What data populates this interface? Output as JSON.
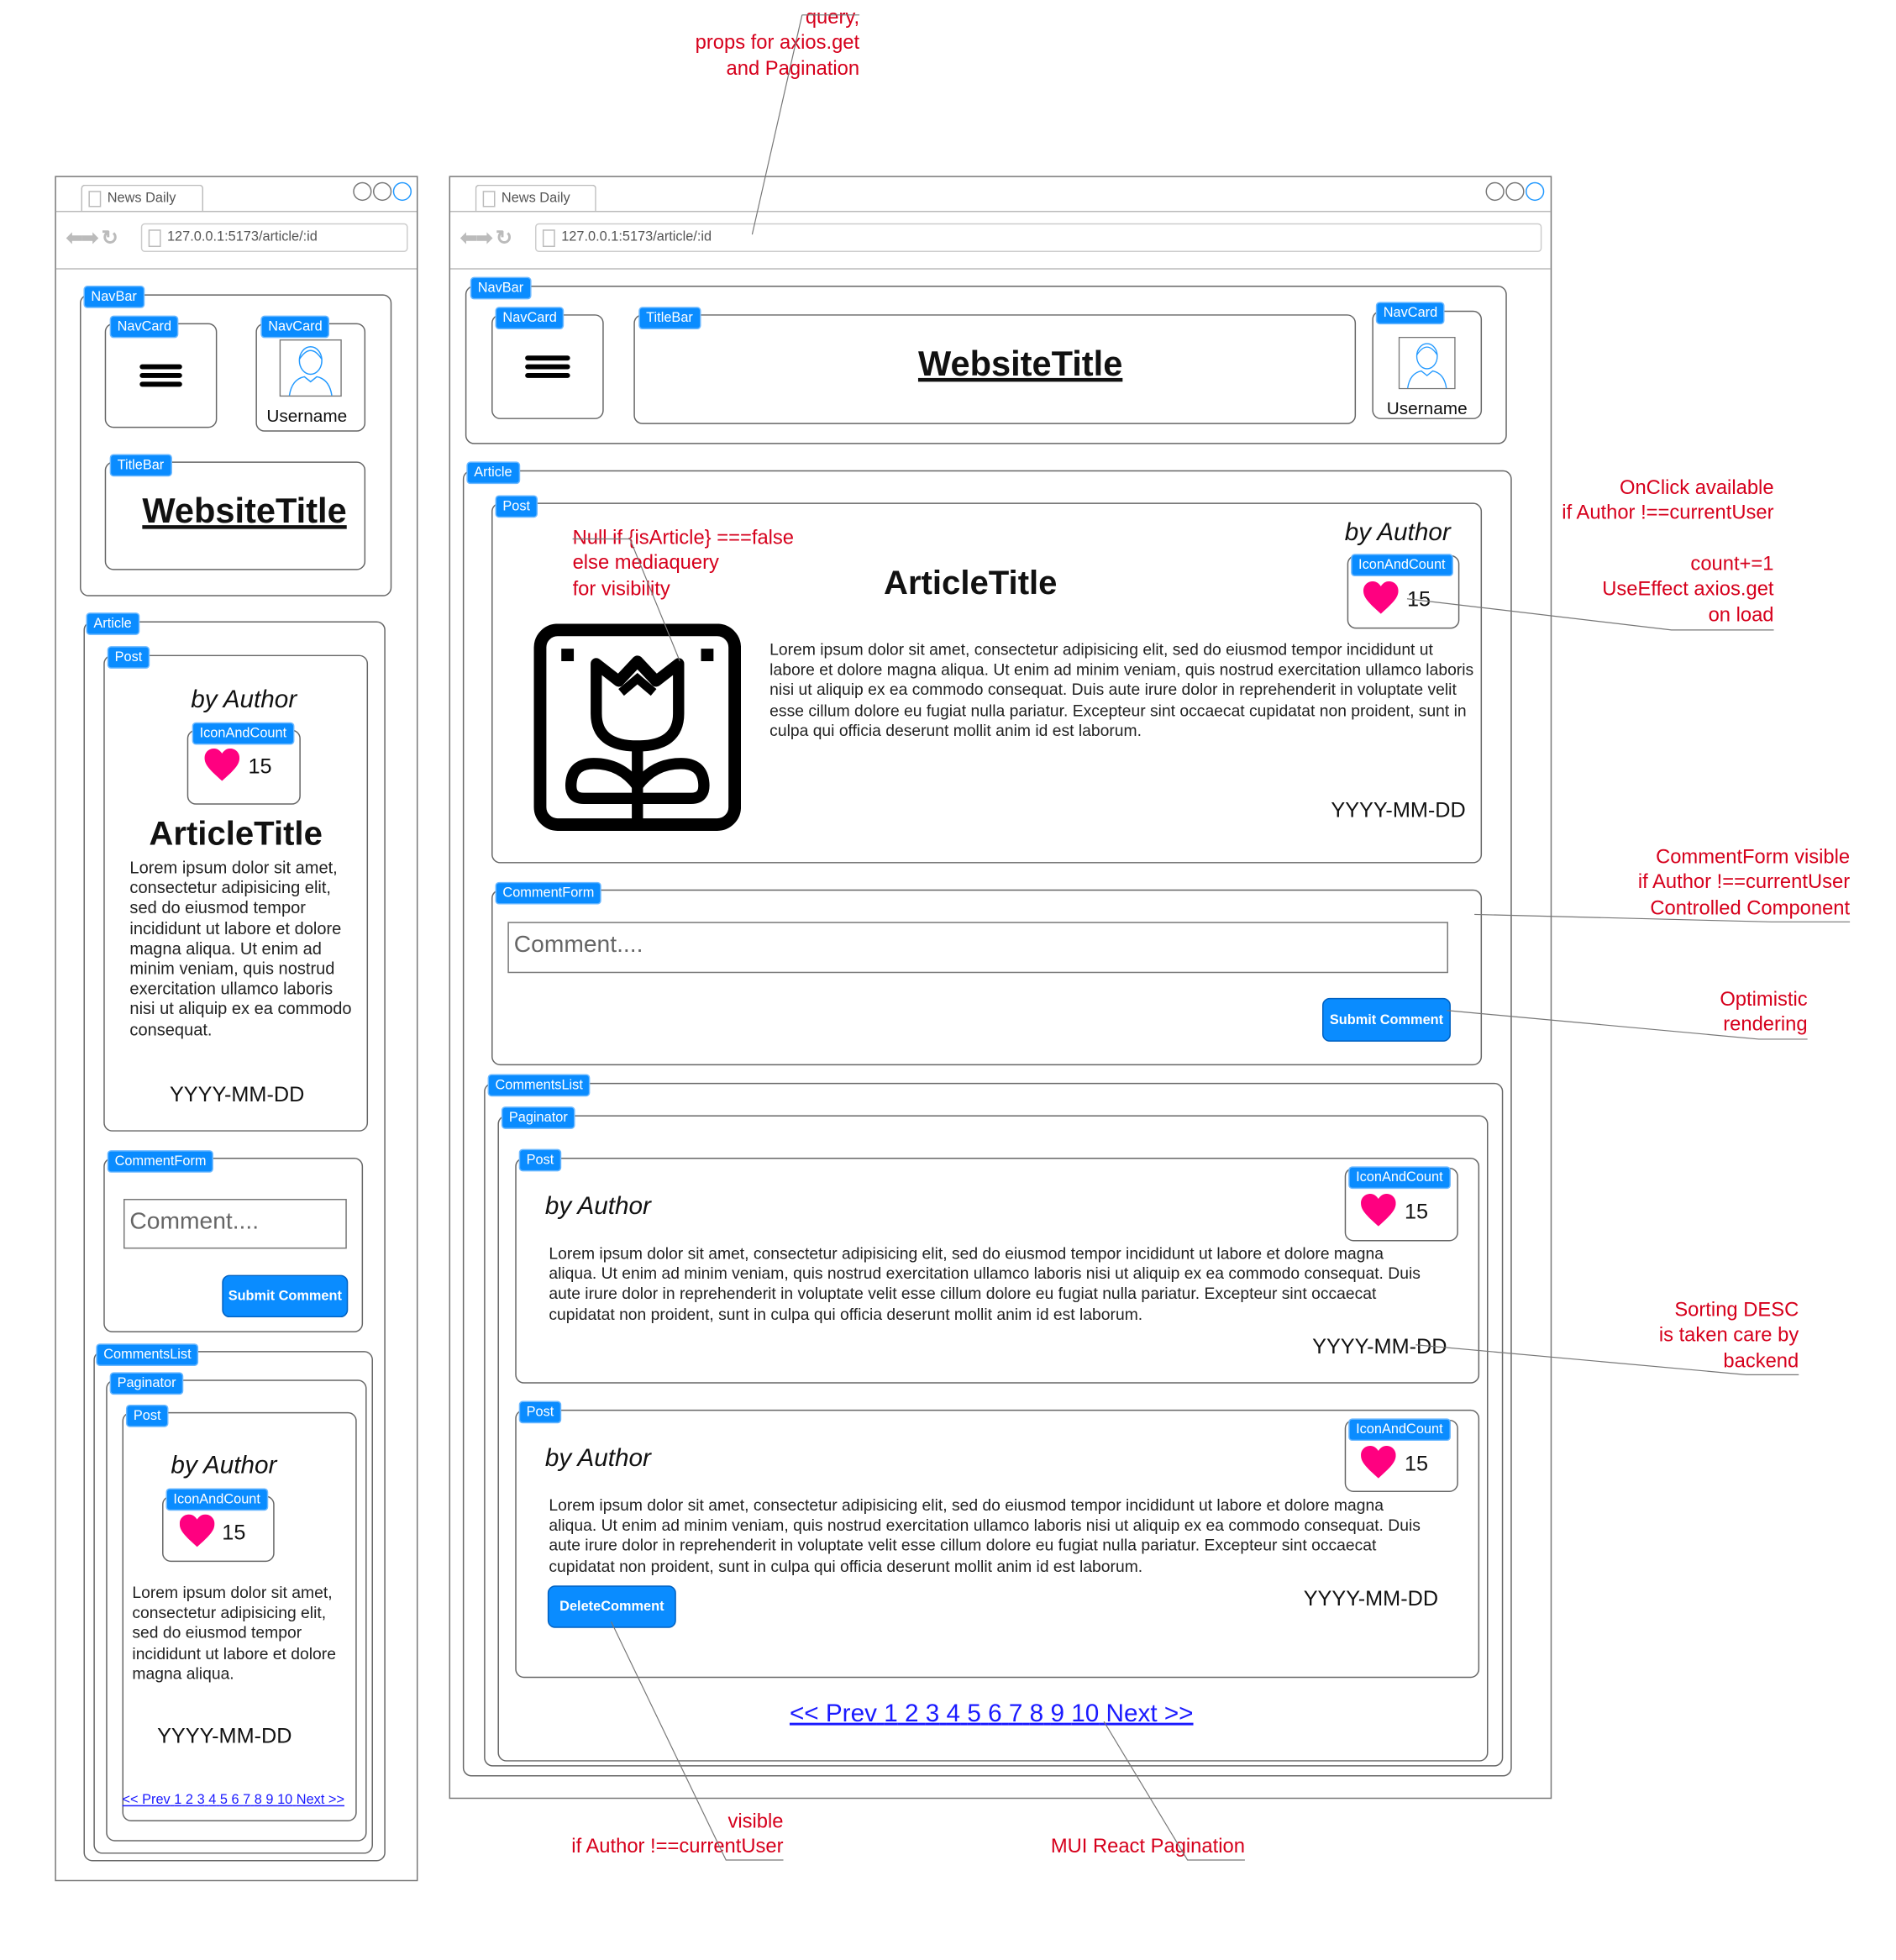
{
  "browser": {
    "tab_title": "News Daily",
    "url": "127.0.0.1:5173/article/:id"
  },
  "labels": {
    "navbar": "NavBar",
    "navcard": "NavCard",
    "titlebar": "TitleBar",
    "article": "Article",
    "post": "Post",
    "icon_and_count": "IconAndCount",
    "comment_form": "CommentForm",
    "comments_list": "CommentsList",
    "paginator": "Paginator"
  },
  "navbar": {
    "website_title": "WebsiteTitle",
    "username": "Username"
  },
  "article": {
    "author": "by Author",
    "title": "ArticleTitle",
    "votes": "15",
    "date": "YYYY-MM-DD",
    "body": "Lorem ipsum dolor sit amet, consectetur adipisicing elit, sed do eiusmod tempor incididunt ut labore et dolore magna aliqua. Ut enim ad minim veniam, quis nostrud exercitation ullamco laboris nisi ut aliquip ex ea commodo consequat. Duis aute irure dolor in reprehenderit in voluptate velit esse cillum dolore eu fugiat nulla pariatur. Excepteur sint occaecat cupidatat non proident, sunt in culpa qui officia deserunt mollit anim id est laborum.",
    "body_mobile": "Lorem ipsum dolor sit amet, consectetur adipisicing elit, sed do eiusmod tempor incididunt ut labore et dolore magna aliqua. Ut enim ad minim veniam, quis nostrud exercitation ullamco laboris nisi ut aliquip ex ea commodo consequat."
  },
  "comment_form": {
    "placeholder": "Comment....",
    "submit_label": "Submit Comment"
  },
  "comments": [
    {
      "author": "by Author",
      "votes": "15",
      "date": "YYYY-MM-DD",
      "body": "Lorem ipsum dolor sit amet, consectetur adipisicing elit, sed do eiusmod tempor incididunt ut labore et dolore magna aliqua. Ut enim ad minim veniam, quis nostrud exercitation ullamco laboris nisi ut aliquip ex ea commodo consequat. Duis aute irure dolor in reprehenderit in voluptate velit esse cillum dolore eu fugiat nulla pariatur. Excepteur sint occaecat cupidatat non proident, sunt in culpa qui officia deserunt mollit anim id est laborum."
    },
    {
      "author": "by Author",
      "votes": "15",
      "date": "YYYY-MM-DD",
      "body": "Lorem ipsum dolor sit amet, consectetur adipisicing elit, sed do eiusmod tempor incididunt ut labore et dolore magna aliqua. Ut enim ad minim veniam, quis nostrud exercitation ullamco laboris nisi ut aliquip ex ea commodo consequat. Duis aute irure dolor in reprehenderit in voluptate velit esse cillum dolore eu fugiat nulla pariatur. Excepteur sint occaecat cupidatat non proident, sunt in culpa qui officia deserunt mollit anim id est laborum.",
      "delete_label": "DeleteComment"
    }
  ],
  "mobile_comment": {
    "author": "by Author",
    "votes": "15",
    "date": "YYYY-MM-DD",
    "body": "Lorem ipsum dolor sit amet, consectetur adipisicing elit, sed do eiusmod tempor incididunt ut labore et dolore magna aliqua."
  },
  "pagination": [
    "<< Prev",
    "1",
    "2",
    "3",
    "4",
    "5",
    "6",
    "7",
    "8",
    "9",
    "10",
    "Next >>"
  ],
  "annotations": {
    "query_props": [
      "query,",
      "props for axios.get",
      "and Pagination"
    ],
    "null_if": [
      "Null if {isArticle} ===false",
      "else mediaquery",
      "for visibility"
    ],
    "onclick": [
      "OnClick available",
      "if Author !==currentUser"
    ],
    "count": [
      "count+=1",
      "UseEffect axios.get",
      "on load"
    ],
    "comment_form": [
      "CommentForm visible",
      "if Author !==currentUser",
      "Controlled Component"
    ],
    "optimistic": [
      "Optimistic",
      "rendering"
    ],
    "sorting": [
      "Sorting DESC",
      "is taken care by",
      "backend"
    ],
    "delete_visible": [
      "visible",
      "if Author !==currentUser"
    ],
    "mui": [
      "MUI React Pagination"
    ]
  },
  "colors": {
    "label_blue": "#0a8cff",
    "annotation_red": "#d6001c",
    "heart_pink": "#ff0080",
    "link_blue": "#1a1aff"
  },
  "icons": [
    "hamburger-menu-icon",
    "user-avatar-icon",
    "heart-icon",
    "tulip-image-icon",
    "back-arrow-icon",
    "forward-arrow-icon",
    "refresh-icon",
    "page-icon",
    "window-control-icon"
  ]
}
